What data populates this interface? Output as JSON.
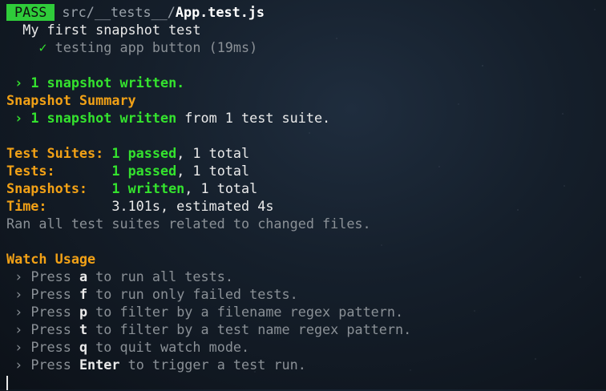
{
  "header": {
    "badge": "PASS",
    "path_dir": "src/__tests__/",
    "path_file": "App.test.js"
  },
  "suite": {
    "name": "My first snapshot test",
    "check": "✓",
    "test_label": "testing app button (19ms)"
  },
  "snapshot_written": {
    "arrow": "›",
    "text": "1 snapshot written."
  },
  "snapshot_summary": {
    "heading": "Snapshot Summary",
    "arrow": "›",
    "highlight": "1 snapshot written",
    "rest": " from 1 test suite."
  },
  "results": {
    "suites_label": "Test Suites:",
    "suites_pass": "1 passed",
    "suites_total": ", 1 total",
    "tests_label": "Tests:",
    "tests_pass": "1 passed",
    "tests_total": ", 1 total",
    "snapshots_label": "Snapshots:",
    "snapshots_written": "1 written",
    "snapshots_total": ", 1 total",
    "time_label": "Time:",
    "time_value": "3.101s, estimated 4s",
    "footer": "Ran all test suites related to changed files."
  },
  "watch": {
    "heading": "Watch Usage",
    "arrow": "›",
    "items": [
      {
        "prefix": "Press ",
        "key": "a",
        "rest": " to run all tests."
      },
      {
        "prefix": "Press ",
        "key": "f",
        "rest": " to run only failed tests."
      },
      {
        "prefix": "Press ",
        "key": "p",
        "rest": " to filter by a filename regex pattern."
      },
      {
        "prefix": "Press ",
        "key": "t",
        "rest": " to filter by a test name regex pattern."
      },
      {
        "prefix": "Press ",
        "key": "q",
        "rest": " to quit watch mode."
      },
      {
        "prefix": "Press ",
        "key": "Enter",
        "rest": " to trigger a test run."
      }
    ]
  },
  "colors": {
    "pass_badge": "#2fcc3a",
    "accent_orange": "#f2a116",
    "accent_green": "#34e22e",
    "muted_gray": "#8a9096"
  }
}
